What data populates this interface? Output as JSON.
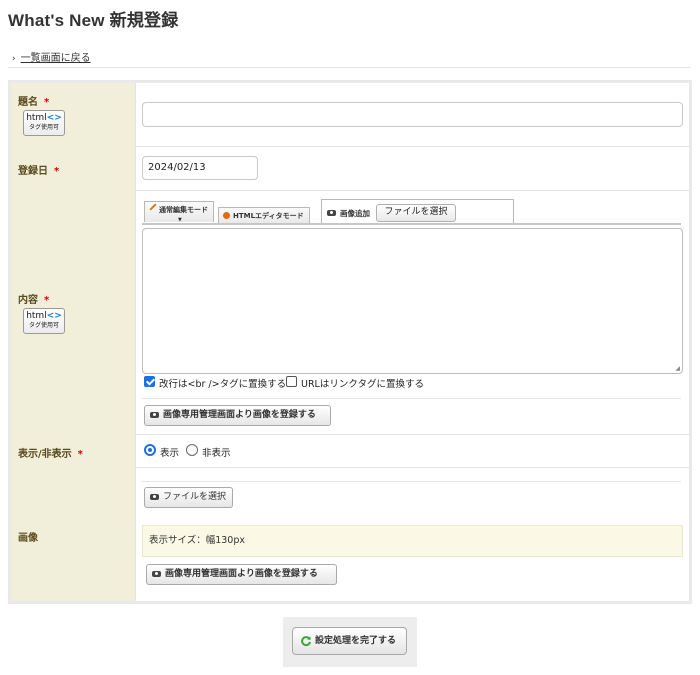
{
  "page": {
    "title": "What's New 新規登録",
    "back_link": "一覧画面に戻る"
  },
  "form": {
    "required_mark": "*",
    "html_badge": {
      "line1": "html",
      "code": "<>",
      "line2": "タグ使用可"
    },
    "title_field": {
      "label": "題名",
      "value": "",
      "placeholder": ""
    },
    "date_field": {
      "label": "登録日",
      "value": "2024/02/13"
    },
    "content_field": {
      "label": "内容",
      "tabs": [
        "通常編集モード",
        "HTMLエディタモード"
      ],
      "image_add_label": "画像追加",
      "file_select_label": "ファイルを選択",
      "editor_value": "",
      "option_br": {
        "label": "改行は<br />タグに置換する",
        "checked": true
      },
      "option_url": {
        "label": "URLはリンクタグに置換する",
        "checked": false
      },
      "register_image_button": "画像専用管理画面より画像を登録する"
    },
    "visibility_field": {
      "label": "表示/非表示",
      "options": [
        {
          "label": "表示",
          "selected": true
        },
        {
          "label": "非表示",
          "selected": false
        }
      ]
    },
    "image_field": {
      "label": "画像",
      "file_select_label": "ファイルを選択",
      "size_note": "表示サイズ：幅130px",
      "register_image_button": "画像専用管理画面より画像を登録する"
    }
  },
  "submit": {
    "label": "設定処理を完了する"
  },
  "colors": {
    "label_bg": "#f1efd9",
    "label_text": "#5b4b20",
    "required": "#d30000",
    "accent": "#1f6fe0",
    "note_bg": "#fbf9e6"
  }
}
